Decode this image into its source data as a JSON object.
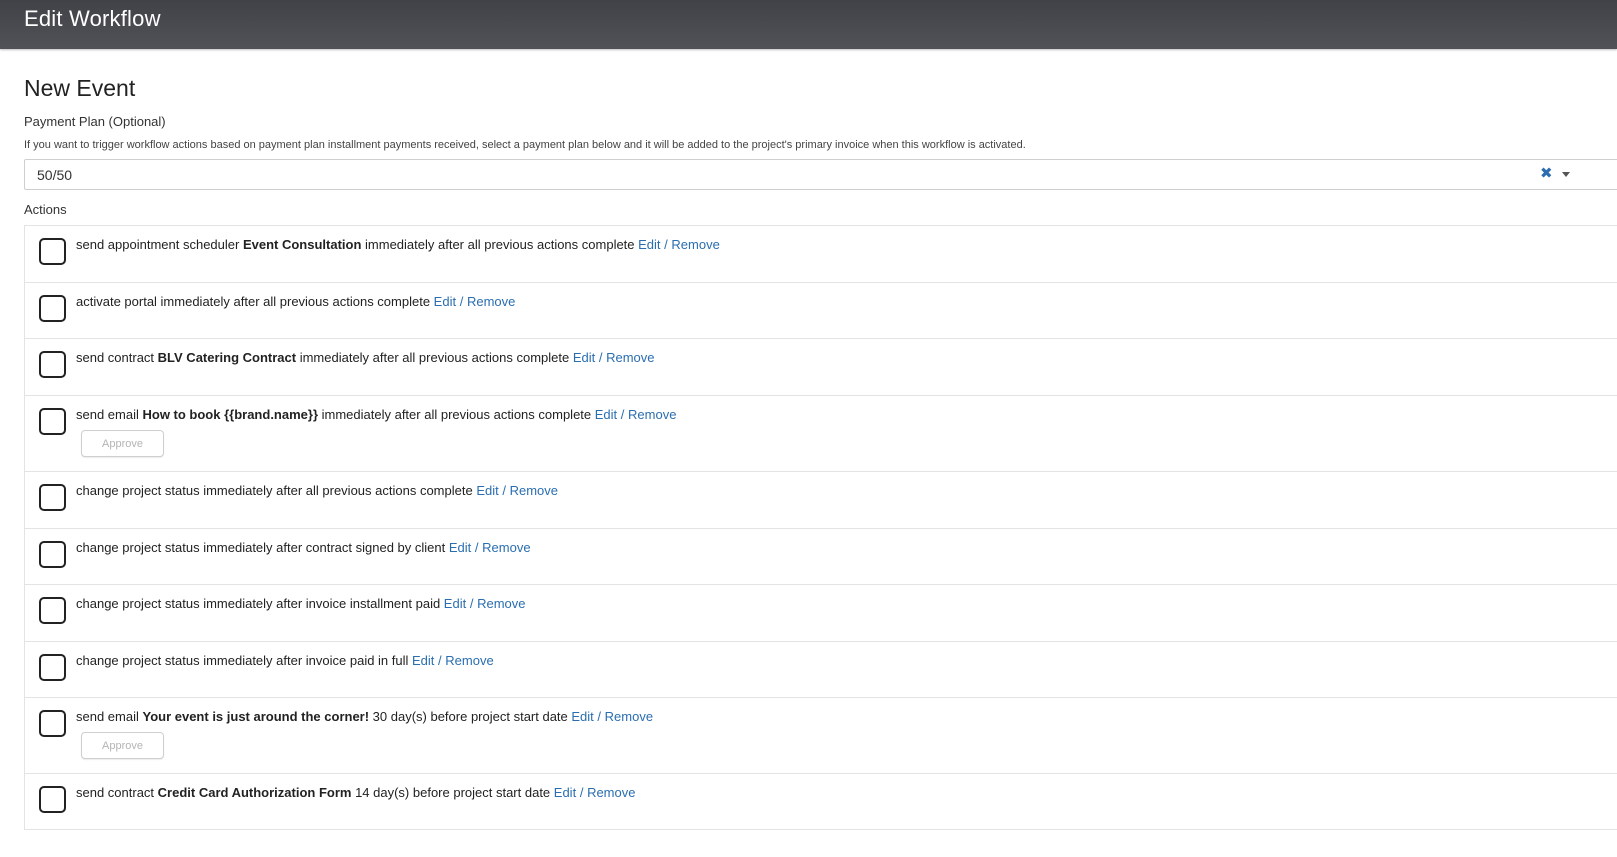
{
  "header": {
    "title": "Edit Workflow"
  },
  "event": {
    "title": "New Event"
  },
  "payment_plan": {
    "label": "Payment Plan (Optional)",
    "help": "If you want to trigger workflow actions based on payment plan installment payments received, select a payment plan below and it will be added to the project's primary invoice when this workflow is activated.",
    "value": "50/50",
    "clear_glyph": "✖"
  },
  "actions": {
    "label": "Actions",
    "edit_label": "Edit",
    "separator": "/",
    "remove_label": "Remove",
    "approve_label": "Approve",
    "items": [
      {
        "prefix": "send appointment scheduler ",
        "bold": "Event Consultation",
        "suffix": " immediately after all previous actions complete ",
        "checked": false
      },
      {
        "prefix": "activate portal immediately after all previous actions complete ",
        "bold": "",
        "suffix": "",
        "checked": false
      },
      {
        "prefix": "send contract ",
        "bold": "BLV Catering Contract",
        "suffix": " immediately after all previous actions complete ",
        "checked": false
      },
      {
        "prefix": "send email ",
        "bold": "How to book {{brand.name}}",
        "suffix": " immediately after all previous actions complete ",
        "checked": false,
        "approve": true
      },
      {
        "prefix": "change project status immediately after all previous actions complete ",
        "bold": "",
        "suffix": "",
        "checked": false
      },
      {
        "prefix": "change project status immediately after contract signed by client ",
        "bold": "",
        "suffix": "",
        "checked": false
      },
      {
        "prefix": "change project status immediately after invoice installment paid ",
        "bold": "",
        "suffix": "",
        "checked": false
      },
      {
        "prefix": "change project status immediately after invoice paid in full ",
        "bold": "",
        "suffix": "",
        "checked": false
      },
      {
        "prefix": "send email ",
        "bold": "Your event is just around the corner!",
        "suffix": " 30 day(s) before project start date ",
        "checked": false,
        "approve": true
      },
      {
        "prefix": "send contract ",
        "bold": "Credit Card Authorization Form",
        "suffix": " 14 day(s) before project start date ",
        "checked": false
      }
    ]
  }
}
